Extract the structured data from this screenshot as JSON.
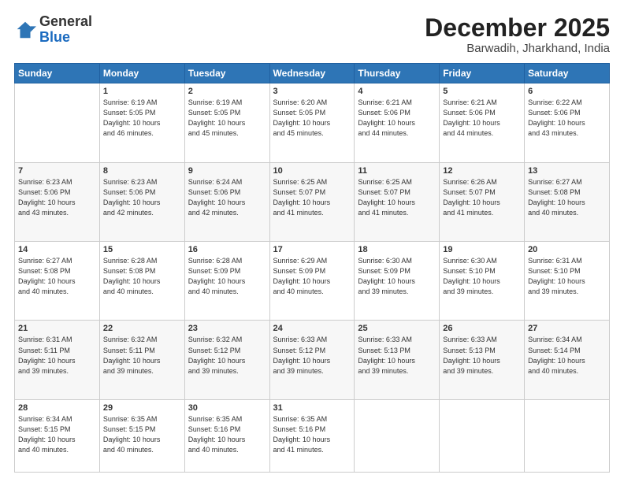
{
  "logo": {
    "general": "General",
    "blue": "Blue"
  },
  "header": {
    "month": "December 2025",
    "location": "Barwadih, Jharkhand, India"
  },
  "days_header": [
    "Sunday",
    "Monday",
    "Tuesday",
    "Wednesday",
    "Thursday",
    "Friday",
    "Saturday"
  ],
  "weeks": [
    [
      {
        "day": "",
        "info": ""
      },
      {
        "day": "1",
        "info": "Sunrise: 6:19 AM\nSunset: 5:05 PM\nDaylight: 10 hours\nand 46 minutes."
      },
      {
        "day": "2",
        "info": "Sunrise: 6:19 AM\nSunset: 5:05 PM\nDaylight: 10 hours\nand 45 minutes."
      },
      {
        "day": "3",
        "info": "Sunrise: 6:20 AM\nSunset: 5:05 PM\nDaylight: 10 hours\nand 45 minutes."
      },
      {
        "day": "4",
        "info": "Sunrise: 6:21 AM\nSunset: 5:06 PM\nDaylight: 10 hours\nand 44 minutes."
      },
      {
        "day": "5",
        "info": "Sunrise: 6:21 AM\nSunset: 5:06 PM\nDaylight: 10 hours\nand 44 minutes."
      },
      {
        "day": "6",
        "info": "Sunrise: 6:22 AM\nSunset: 5:06 PM\nDaylight: 10 hours\nand 43 minutes."
      }
    ],
    [
      {
        "day": "7",
        "info": "Sunrise: 6:23 AM\nSunset: 5:06 PM\nDaylight: 10 hours\nand 43 minutes."
      },
      {
        "day": "8",
        "info": "Sunrise: 6:23 AM\nSunset: 5:06 PM\nDaylight: 10 hours\nand 42 minutes."
      },
      {
        "day": "9",
        "info": "Sunrise: 6:24 AM\nSunset: 5:06 PM\nDaylight: 10 hours\nand 42 minutes."
      },
      {
        "day": "10",
        "info": "Sunrise: 6:25 AM\nSunset: 5:07 PM\nDaylight: 10 hours\nand 41 minutes."
      },
      {
        "day": "11",
        "info": "Sunrise: 6:25 AM\nSunset: 5:07 PM\nDaylight: 10 hours\nand 41 minutes."
      },
      {
        "day": "12",
        "info": "Sunrise: 6:26 AM\nSunset: 5:07 PM\nDaylight: 10 hours\nand 41 minutes."
      },
      {
        "day": "13",
        "info": "Sunrise: 6:27 AM\nSunset: 5:08 PM\nDaylight: 10 hours\nand 40 minutes."
      }
    ],
    [
      {
        "day": "14",
        "info": "Sunrise: 6:27 AM\nSunset: 5:08 PM\nDaylight: 10 hours\nand 40 minutes."
      },
      {
        "day": "15",
        "info": "Sunrise: 6:28 AM\nSunset: 5:08 PM\nDaylight: 10 hours\nand 40 minutes."
      },
      {
        "day": "16",
        "info": "Sunrise: 6:28 AM\nSunset: 5:09 PM\nDaylight: 10 hours\nand 40 minutes."
      },
      {
        "day": "17",
        "info": "Sunrise: 6:29 AM\nSunset: 5:09 PM\nDaylight: 10 hours\nand 40 minutes."
      },
      {
        "day": "18",
        "info": "Sunrise: 6:30 AM\nSunset: 5:09 PM\nDaylight: 10 hours\nand 39 minutes."
      },
      {
        "day": "19",
        "info": "Sunrise: 6:30 AM\nSunset: 5:10 PM\nDaylight: 10 hours\nand 39 minutes."
      },
      {
        "day": "20",
        "info": "Sunrise: 6:31 AM\nSunset: 5:10 PM\nDaylight: 10 hours\nand 39 minutes."
      }
    ],
    [
      {
        "day": "21",
        "info": "Sunrise: 6:31 AM\nSunset: 5:11 PM\nDaylight: 10 hours\nand 39 minutes."
      },
      {
        "day": "22",
        "info": "Sunrise: 6:32 AM\nSunset: 5:11 PM\nDaylight: 10 hours\nand 39 minutes."
      },
      {
        "day": "23",
        "info": "Sunrise: 6:32 AM\nSunset: 5:12 PM\nDaylight: 10 hours\nand 39 minutes."
      },
      {
        "day": "24",
        "info": "Sunrise: 6:33 AM\nSunset: 5:12 PM\nDaylight: 10 hours\nand 39 minutes."
      },
      {
        "day": "25",
        "info": "Sunrise: 6:33 AM\nSunset: 5:13 PM\nDaylight: 10 hours\nand 39 minutes."
      },
      {
        "day": "26",
        "info": "Sunrise: 6:33 AM\nSunset: 5:13 PM\nDaylight: 10 hours\nand 39 minutes."
      },
      {
        "day": "27",
        "info": "Sunrise: 6:34 AM\nSunset: 5:14 PM\nDaylight: 10 hours\nand 40 minutes."
      }
    ],
    [
      {
        "day": "28",
        "info": "Sunrise: 6:34 AM\nSunset: 5:15 PM\nDaylight: 10 hours\nand 40 minutes."
      },
      {
        "day": "29",
        "info": "Sunrise: 6:35 AM\nSunset: 5:15 PM\nDaylight: 10 hours\nand 40 minutes."
      },
      {
        "day": "30",
        "info": "Sunrise: 6:35 AM\nSunset: 5:16 PM\nDaylight: 10 hours\nand 40 minutes."
      },
      {
        "day": "31",
        "info": "Sunrise: 6:35 AM\nSunset: 5:16 PM\nDaylight: 10 hours\nand 41 minutes."
      },
      {
        "day": "",
        "info": ""
      },
      {
        "day": "",
        "info": ""
      },
      {
        "day": "",
        "info": ""
      }
    ]
  ]
}
